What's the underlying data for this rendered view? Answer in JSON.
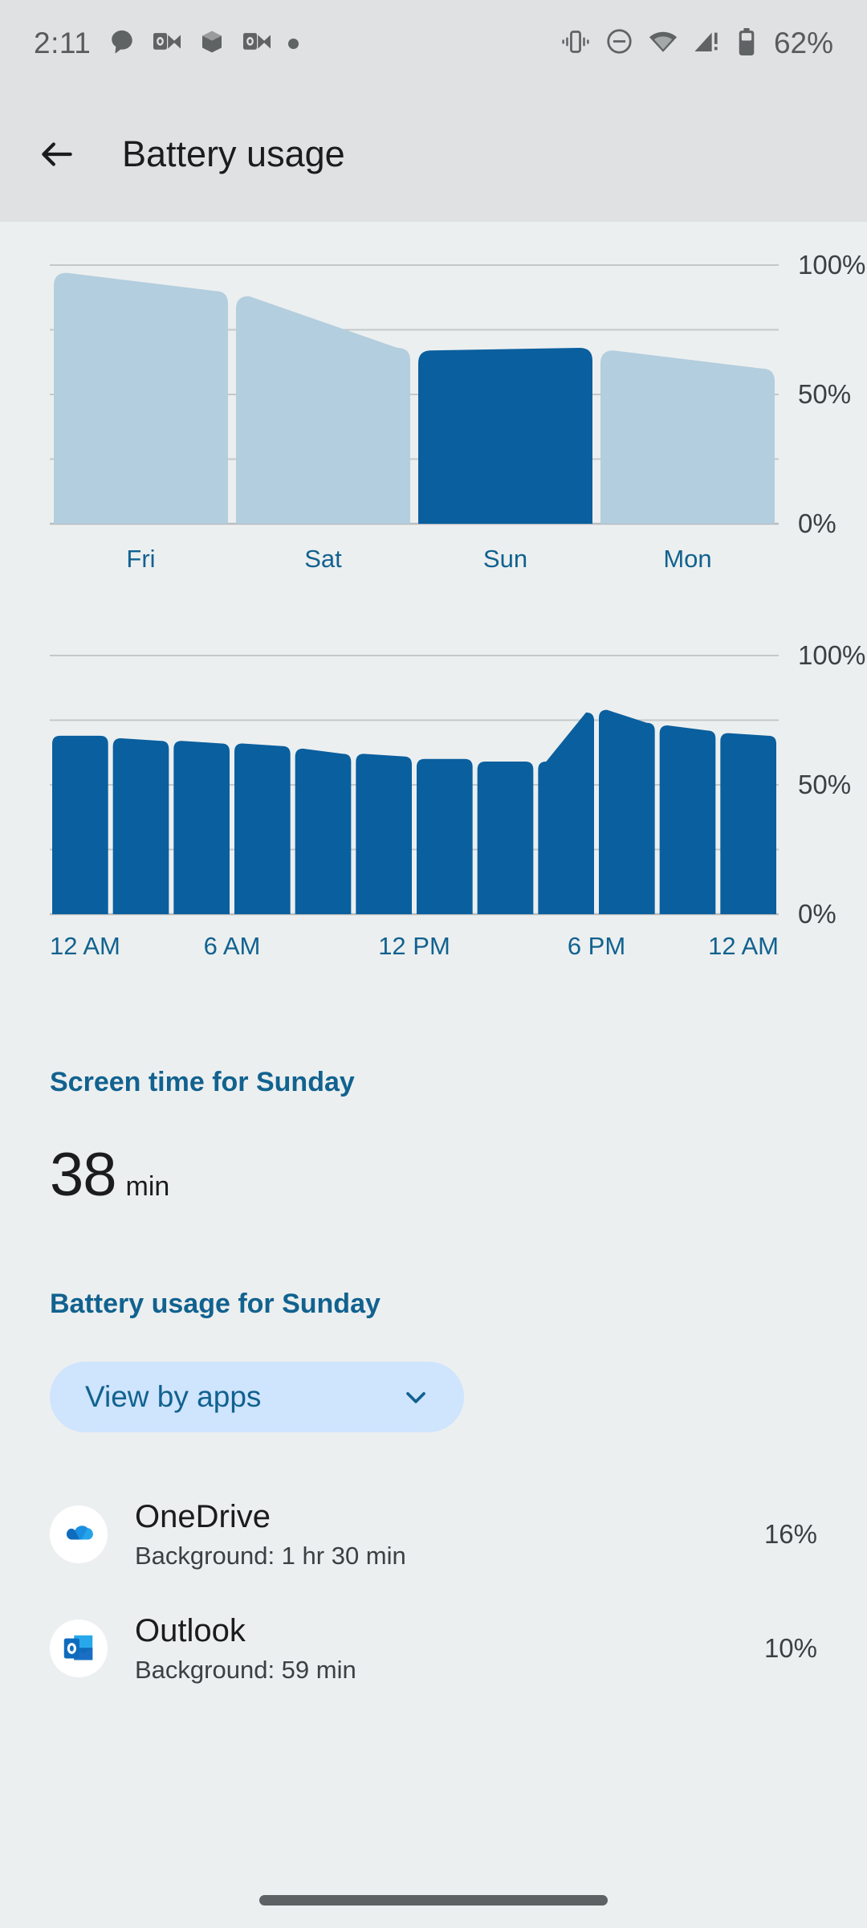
{
  "statusbar": {
    "time": "2:11",
    "battery_percent": "62%",
    "notification_icons": [
      "chat-bubble-icon",
      "outlook-icon",
      "package-icon",
      "outlook-icon",
      "more-notifications-dot"
    ],
    "system_icons": [
      "vibrate-icon",
      "do-not-disturb-icon",
      "wifi-icon",
      "cellular-signal-warning-icon",
      "battery-icon"
    ]
  },
  "appbar": {
    "back_icon": "back-arrow-icon",
    "title": "Battery usage"
  },
  "chart_data": [
    {
      "type": "area",
      "name": "daily-battery-level",
      "title": "",
      "xlabel": "",
      "ylabel": "",
      "categories": [
        "Fri",
        "Sat",
        "Sun",
        "Mon"
      ],
      "selected_category": "Sun",
      "ylim": [
        0,
        100
      ],
      "ytick_labels": [
        "0%",
        "50%",
        "100%"
      ],
      "ytick_values": [
        0,
        50,
        100
      ],
      "gridlines": [
        0,
        25,
        50,
        75,
        100
      ],
      "grid": true,
      "series": [
        {
          "name": "Battery level",
          "points": [
            {
              "x": "Fri",
              "start": 97,
              "end": 90
            },
            {
              "x": "Sat",
              "start": 88,
              "end": 68
            },
            {
              "x": "Sun",
              "start": 67,
              "end": 68
            },
            {
              "x": "Mon",
              "start": 67,
              "end": 60
            }
          ]
        }
      ]
    },
    {
      "type": "area",
      "name": "hourly-battery-level",
      "title": "",
      "xlabel": "",
      "ylabel": "",
      "ylim": [
        0,
        100
      ],
      "ytick_labels": [
        "0%",
        "50%",
        "100%"
      ],
      "ytick_values": [
        0,
        50,
        100
      ],
      "gridlines": [
        0,
        25,
        50,
        75,
        100
      ],
      "grid": true,
      "xtick_labels": [
        "12 AM",
        "6 AM",
        "12 PM",
        "6 PM",
        "12 AM"
      ],
      "series": [
        {
          "name": "Battery level",
          "points": [
            {
              "x": "12 AM",
              "start": 69,
              "end": 69
            },
            {
              "x": "2 AM",
              "start": 68,
              "end": 67
            },
            {
              "x": "4 AM",
              "start": 67,
              "end": 66
            },
            {
              "x": "6 AM",
              "start": 66,
              "end": 65
            },
            {
              "x": "8 AM",
              "start": 64,
              "end": 62
            },
            {
              "x": "10 AM",
              "start": 62,
              "end": 61
            },
            {
              "x": "12 PM",
              "start": 60,
              "end": 60
            },
            {
              "x": "2 PM",
              "start": 59,
              "end": 59
            },
            {
              "x": "4 PM",
              "start": 59,
              "end": 78
            },
            {
              "x": "6 PM",
              "start": 79,
              "end": 74
            },
            {
              "x": "8 PM",
              "start": 73,
              "end": 71
            },
            {
              "x": "10 PM",
              "start": 70,
              "end": 69
            }
          ]
        }
      ]
    }
  ],
  "screen_time": {
    "heading": "Screen time for Sunday",
    "value": "38",
    "unit": "min"
  },
  "battery_usage": {
    "heading": "Battery usage for Sunday",
    "filter_chip": {
      "label": "View by apps",
      "icon": "chevron-down-icon"
    },
    "apps": [
      {
        "name": "OneDrive",
        "detail": "Background: 1 hr 30 min",
        "percent": "16%",
        "icon": "onedrive-icon"
      },
      {
        "name": "Outlook",
        "detail": "Background: 59 min",
        "percent": "10%",
        "icon": "outlook-icon"
      }
    ]
  },
  "navbar": {
    "handle": "gesture-nav-handle"
  },
  "colors": {
    "accent": "#11628f",
    "bar_selected": "#0a5f9e",
    "bar_unselected": "#b3cede",
    "chip_bg": "#cfe4fd",
    "page_bg": "#eceff0",
    "bar_bg": "#dfe1e2"
  }
}
